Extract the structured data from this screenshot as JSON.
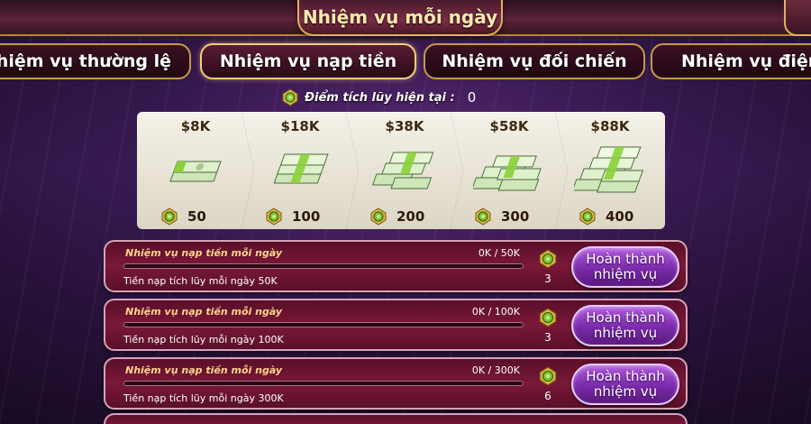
{
  "header": {
    "title": "Nhiệm vụ mỗi ngày"
  },
  "tabs": [
    {
      "label": "Nhiệm vụ thường lệ",
      "active": false
    },
    {
      "label": "Nhiệm vụ nạp tiền",
      "active": true
    },
    {
      "label": "Nhiệm vụ đối chiến",
      "active": false
    },
    {
      "label": "Nhiệm vụ điện",
      "active": false
    }
  ],
  "points": {
    "label": "Điểm tích lũy hiện tại :",
    "value": "0"
  },
  "rewards": [
    {
      "amount": "$8K",
      "points": "50",
      "icon": "cash-stack-icon"
    },
    {
      "amount": "$18K",
      "points": "100",
      "icon": "cash-stack-icon"
    },
    {
      "amount": "$38K",
      "points": "200",
      "icon": "cash-stack-icon"
    },
    {
      "amount": "$58K",
      "points": "300",
      "icon": "cash-stack-icon"
    },
    {
      "amount": "$88K",
      "points": "400",
      "icon": "cash-stack-icon"
    }
  ],
  "missions": [
    {
      "title": "Nhiệm vụ nạp tiền mỗi ngày",
      "progress": "0K / 50K",
      "progress_fraction": 0,
      "desc": "Tiền nạp tích lũy mỗi ngày 50K",
      "reward": "3",
      "button_line1": "Hoàn thành",
      "button_line2": "nhiệm vụ"
    },
    {
      "title": "Nhiệm vụ nạp tiền mỗi ngày",
      "progress": "0K / 100K",
      "progress_fraction": 0,
      "desc": "Tiền nạp tích lũy mỗi ngày 100K",
      "reward": "3",
      "button_line1": "Hoàn thành",
      "button_line2": "nhiệm vụ"
    },
    {
      "title": "Nhiệm vụ nạp tiền mỗi ngày",
      "progress": "0K / 300K",
      "progress_fraction": 0,
      "desc": "Tiền nạp tích lũy mỗi ngày 300K",
      "reward": "6",
      "button_line1": "Hoàn thành",
      "button_line2": "nhiệm vụ"
    }
  ],
  "colors": {
    "accent_gold": "#e0b25a",
    "medal_green": "#7cc23a",
    "button_purple": "#8a34b8",
    "row_maroon": "#6a1430"
  }
}
